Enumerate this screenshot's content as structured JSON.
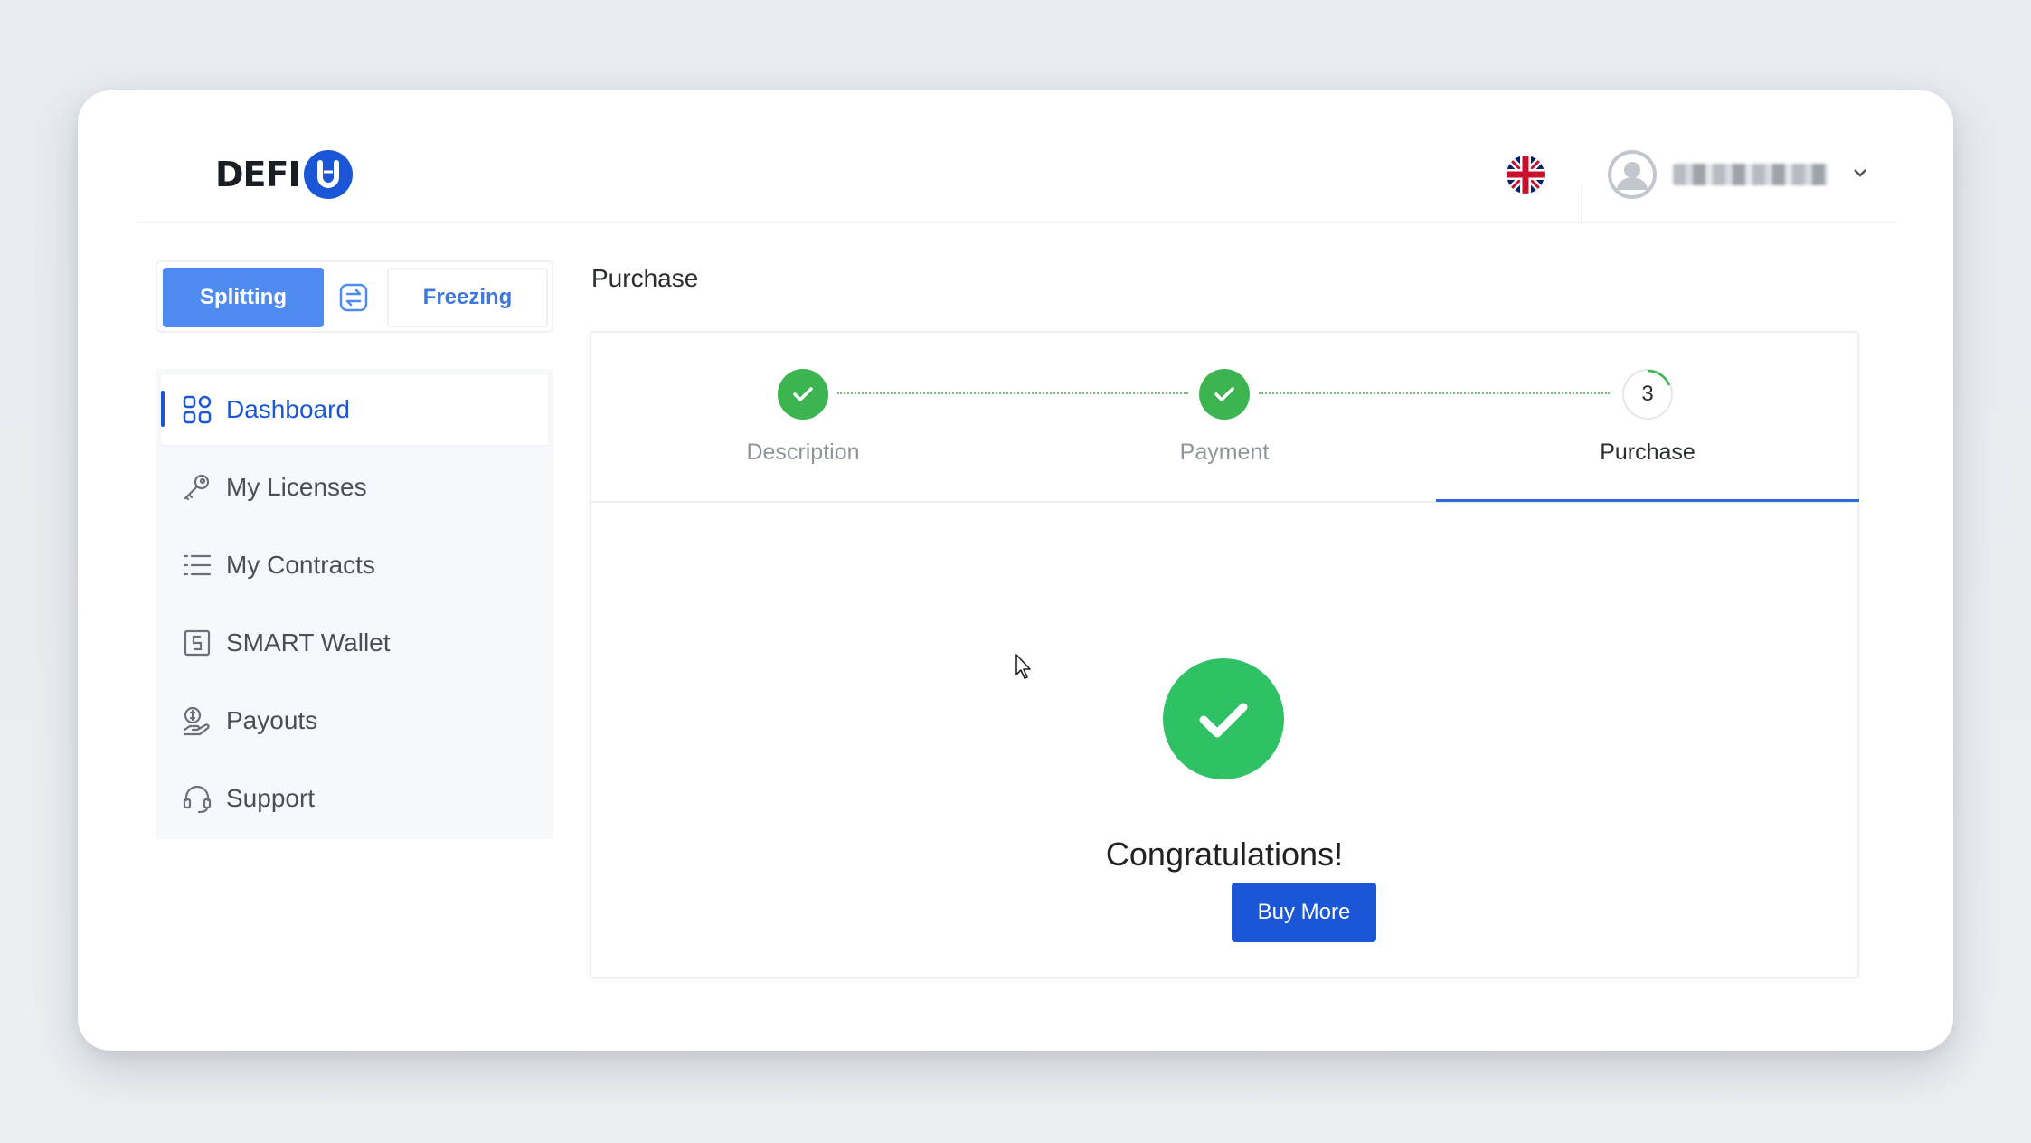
{
  "header": {
    "logo_text": "DEFI",
    "logo_badge": "U",
    "language_icon": "uk-flag-icon",
    "user": {
      "name": "",
      "menu_icon": "chevron-down-icon"
    }
  },
  "mode_toggle": {
    "splitting_label": "Splitting",
    "freezing_label": "Freezing",
    "swap_icon": "swap-icon",
    "active": "Splitting",
    "accent_color": "#4f8af0"
  },
  "sidebar": {
    "items": [
      {
        "label": "Dashboard",
        "icon": "grid-icon",
        "active": true
      },
      {
        "label": "My Licenses",
        "icon": "key-icon",
        "active": false
      },
      {
        "label": "My Contracts",
        "icon": "list-icon",
        "active": false
      },
      {
        "label": "SMART Wallet",
        "icon": "wallet-icon",
        "active": false
      },
      {
        "label": "Payouts",
        "icon": "payouts-icon",
        "active": false
      },
      {
        "label": "Support",
        "icon": "headset-icon",
        "active": false
      }
    ]
  },
  "main": {
    "page_title": "Purchase",
    "steps": [
      {
        "label": "Description",
        "status": "done"
      },
      {
        "label": "Payment",
        "status": "done"
      },
      {
        "label": "Purchase",
        "status": "current",
        "number": "3"
      }
    ],
    "success_message": "Congratulations!",
    "buy_more_label": "Buy More",
    "colors": {
      "success": "#2ec265",
      "primary": "#1a56d6",
      "step_done": "#3cb550"
    }
  }
}
